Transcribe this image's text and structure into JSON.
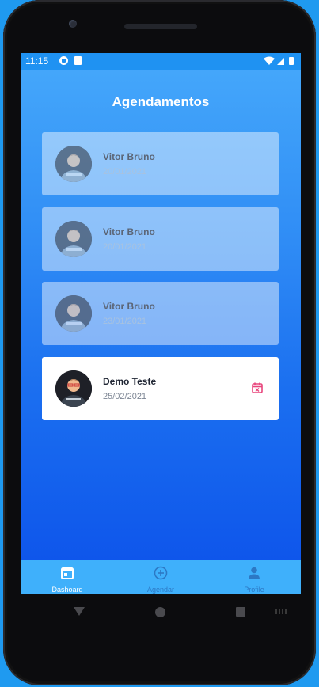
{
  "status_bar": {
    "time": "11:15"
  },
  "header": {
    "title": "Agendamentos"
  },
  "appointments": [
    {
      "name": "Vitor Bruno",
      "date": "20/01/2021",
      "state": "past"
    },
    {
      "name": "Vitor Bruno",
      "date": "20/01/2021",
      "state": "past"
    },
    {
      "name": "Vitor Bruno",
      "date": "23/01/2021",
      "state": "past"
    },
    {
      "name": "Demo Teste",
      "date": "25/02/2021",
      "state": "active",
      "action_icon": "calendar-cancel-icon"
    }
  ],
  "tabbar": {
    "tabs": [
      {
        "label": "Dashoard",
        "icon": "calendar-icon",
        "active": true
      },
      {
        "label": "Agendar",
        "icon": "plus-circle-icon",
        "active": false
      },
      {
        "label": "Profile",
        "icon": "person-icon",
        "active": false
      }
    ]
  },
  "colors": {
    "accent": "#3fb0fb",
    "cancel_icon": "#e8457c",
    "gradient_top": "#46a9fb",
    "gradient_bottom": "#0c51ea"
  }
}
